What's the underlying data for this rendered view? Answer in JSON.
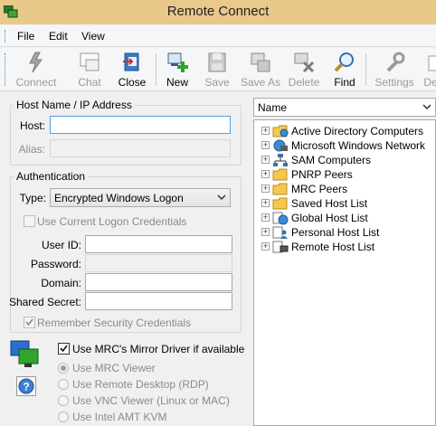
{
  "window": {
    "title": "Remote Connect"
  },
  "menu": [
    "File",
    "Edit",
    "View"
  ],
  "toolbar": [
    {
      "label": "Connect",
      "icon": "lightning-icon",
      "enabled": false
    },
    {
      "label": "Chat",
      "icon": "chat-icon",
      "enabled": false
    },
    {
      "label": "Close",
      "icon": "close-connection-icon",
      "enabled": true
    },
    {
      "label": "New",
      "icon": "new-host-icon",
      "enabled": true
    },
    {
      "label": "Save",
      "icon": "save-icon",
      "enabled": false
    },
    {
      "label": "Save As",
      "icon": "save-as-icon",
      "enabled": false
    },
    {
      "label": "Delete",
      "icon": "delete-icon",
      "enabled": false
    },
    {
      "label": "Find",
      "icon": "find-icon",
      "enabled": true
    },
    {
      "label": "Settings",
      "icon": "wrench-icon",
      "enabled": false
    },
    {
      "label": "De",
      "icon": "default-icon",
      "enabled": false
    }
  ],
  "host_group": {
    "legend": "Host Name / IP Address",
    "host_label": "Host:",
    "host_value": "",
    "alias_label": "Alias:",
    "alias_value": ""
  },
  "auth_group": {
    "legend": "Authentication",
    "type_label": "Type:",
    "type_value": "Encrypted Windows Logon",
    "use_current_label": "Use Current Logon Credentials",
    "userid_label": "User ID:",
    "password_label": "Password:",
    "domain_label": "Domain:",
    "secret_label": "Shared Secret:",
    "remember_label": "Remember Security Credentials"
  },
  "viewer": {
    "mirror_label": "Use MRC's Mirror Driver if available",
    "options": [
      "Use MRC Viewer",
      "Use Remote Desktop (RDP)",
      "Use VNC Viewer (Linux or MAC)",
      "Use Intel AMT KVM"
    ]
  },
  "tree": {
    "sort_value": "Name",
    "items": [
      {
        "label": "Active Directory Computers",
        "icon": "folder-globe-icon"
      },
      {
        "label": "Microsoft Windows Network",
        "icon": "network-globe-icon"
      },
      {
        "label": "SAM Computers",
        "icon": "sam-network-icon"
      },
      {
        "label": "PNRP Peers",
        "icon": "folder-icon"
      },
      {
        "label": "MRC Peers",
        "icon": "folder-icon"
      },
      {
        "label": "Saved Host List",
        "icon": "folder-icon"
      },
      {
        "label": "Global Host List",
        "icon": "globe-list-icon"
      },
      {
        "label": "Personal Host List",
        "icon": "person-list-icon"
      },
      {
        "label": "Remote Host List",
        "icon": "remote-list-icon"
      }
    ]
  },
  "colors": {
    "titlebar": "#e9c98a",
    "accent": "#569de5",
    "folder": "#f5c84c"
  }
}
